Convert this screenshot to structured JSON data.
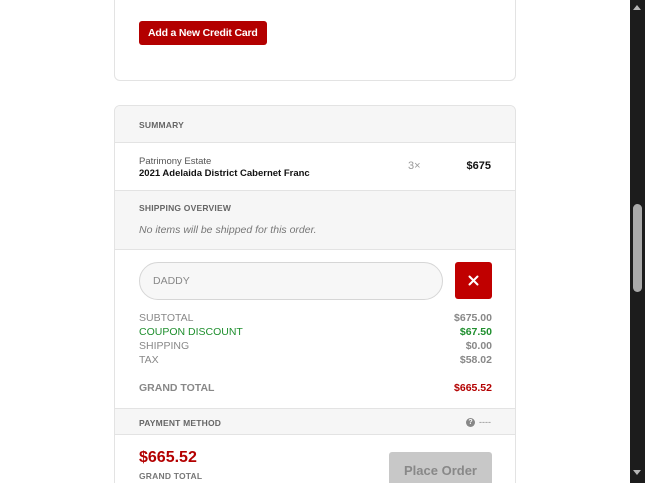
{
  "payment": {
    "add_card_label": "Add a New Credit Card",
    "section_title": "PAYMENT METHOD",
    "status_text": "----",
    "info_icon": "info-icon"
  },
  "summary": {
    "title": "SUMMARY",
    "item": {
      "producer": "Patrimony Estate",
      "name": "2021 Adelaida District Cabernet Franc",
      "quantity": "3×",
      "price": "$675"
    }
  },
  "shipping": {
    "title": "SHIPPING OVERVIEW",
    "note": "No items will be shipped for this order."
  },
  "coupon": {
    "value": "DADDY",
    "remove_icon": "close-icon"
  },
  "totals": {
    "subtotal_label": "SUBTOTAL",
    "subtotal_value": "$675.00",
    "discount_label": "COUPON DISCOUNT",
    "discount_value": "$67.50",
    "shipping_label": "SHIPPING",
    "shipping_value": "$0.00",
    "tax_label": "TAX",
    "tax_value": "$58.02",
    "grand_label": "GRAND TOTAL",
    "grand_value": "$665.52"
  },
  "footer": {
    "total": "$665.52",
    "total_label": "GRAND TOTAL",
    "place_order_label": "Place Order"
  },
  "colors": {
    "brand_red": "#b30000",
    "discount_green": "#1f8f2e",
    "disabled_gray": "#c8c8c8"
  }
}
